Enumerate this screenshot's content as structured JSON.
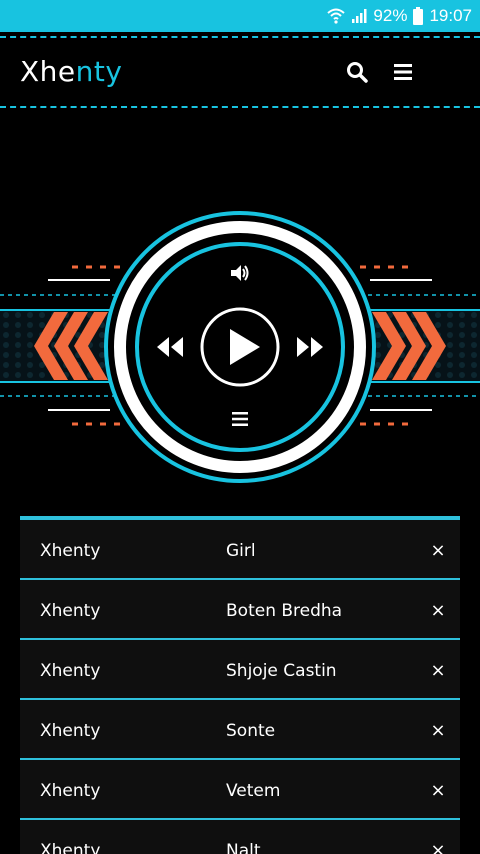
{
  "status_bar": {
    "battery": "92%",
    "time": "19:07",
    "icons": [
      "wifi-icon",
      "signal-icon",
      "battery-icon"
    ]
  },
  "header": {
    "logo_part1": "Xhe",
    "logo_part2": "nty",
    "search_icon": "search-icon",
    "menu_icon": "hamburger-menu-icon"
  },
  "player": {
    "icons": [
      "volume-icon",
      "rewind-icon",
      "play-icon",
      "fast-forward-icon",
      "playlist-menu-icon"
    ]
  },
  "playlist": {
    "rows": [
      {
        "artist": "Xhenty",
        "title": "Girl",
        "remove": "×"
      },
      {
        "artist": "Xhenty",
        "title": "Boten Bredha",
        "remove": "×"
      },
      {
        "artist": "Xhenty",
        "title": "Shjoje Castin",
        "remove": "×"
      },
      {
        "artist": "Xhenty",
        "title": "Sonte",
        "remove": "×"
      },
      {
        "artist": "Xhenty",
        "title": "Vetem",
        "remove": "×"
      },
      {
        "artist": "Xhenty",
        "title": "Nalt",
        "remove": "×"
      }
    ]
  },
  "colors": {
    "accent": "#18c3e0",
    "orange": "#f26a3d",
    "background": "#000000",
    "row_bg": "#0f0f0f"
  }
}
